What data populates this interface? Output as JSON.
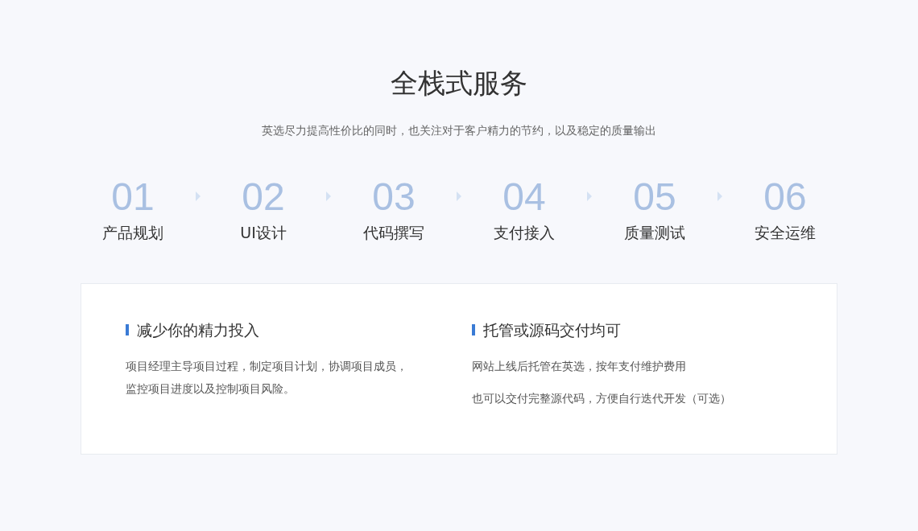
{
  "title": "全栈式服务",
  "subtitle": "英选尽力提高性价比的同时，也关注对于客户精力的节约，以及稳定的质量输出",
  "steps": [
    {
      "number": "01",
      "label": "产品规划"
    },
    {
      "number": "02",
      "label": "UI设计"
    },
    {
      "number": "03",
      "label": "代码撰写"
    },
    {
      "number": "04",
      "label": "支付接入"
    },
    {
      "number": "05",
      "label": "质量测试"
    },
    {
      "number": "06",
      "label": "安全运维"
    }
  ],
  "card": {
    "columns": [
      {
        "heading": "减少你的精力投入",
        "paragraphs": [
          "项目经理主导项目过程，制定项目计划，协调项目成员，监控项目进度以及控制项目风险。"
        ]
      },
      {
        "heading": "托管或源码交付均可",
        "paragraphs": [
          "网站上线后托管在英选，按年支付维护费用",
          "也可以交付完整源代码，方便自行迭代开发（可选）"
        ]
      }
    ]
  }
}
